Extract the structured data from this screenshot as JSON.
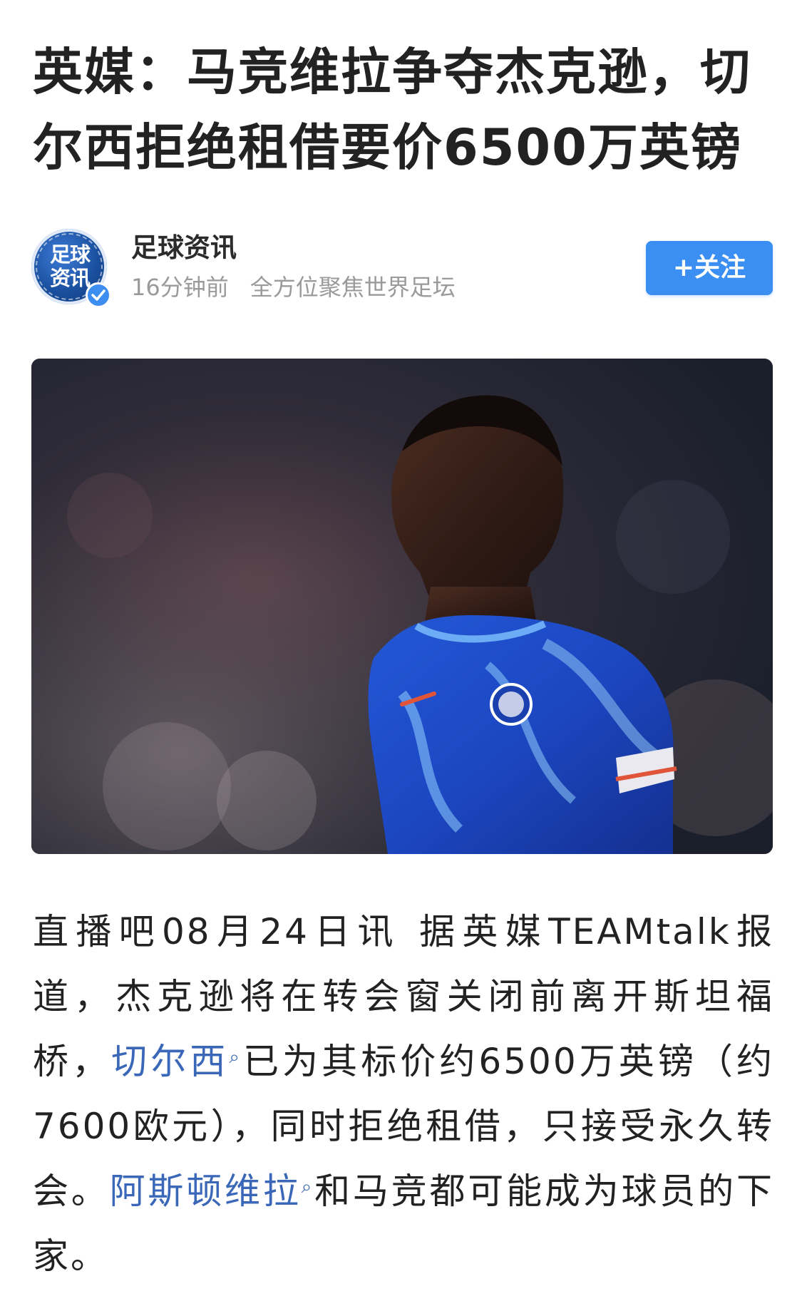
{
  "article": {
    "title": "英媒：马竞维拉争夺杰克逊，切尔西拒绝租借要价6500万英镑"
  },
  "author": {
    "avatar_text": "足球资讯",
    "name": "足球资讯",
    "time_ago": "16分钟前",
    "bio": "全方位聚焦世界足坛",
    "verified_icon": "verified-check-icon"
  },
  "follow_button": {
    "label": "+关注",
    "color": "#3b8ef2"
  },
  "hero_image": {
    "alt": ""
  },
  "body": {
    "part1": "直播吧08月24日讯  据英媒TEAMtalk报道，杰克逊将在转会窗关闭前离开斯坦福桥，",
    "link1": "切尔西",
    "link1_icon": "search-icon",
    "part2": "已为其标价约6500万英镑（约7600欧元），同时拒绝租借，只接受永久转会。",
    "link2": "阿斯顿维拉",
    "link2_icon": "search-icon",
    "part3": "和马竞都可能成为球员的下家。"
  },
  "colors": {
    "link": "#3a67b8",
    "accent": "#3b8ef2",
    "meta_text": "#9a9a9a"
  }
}
